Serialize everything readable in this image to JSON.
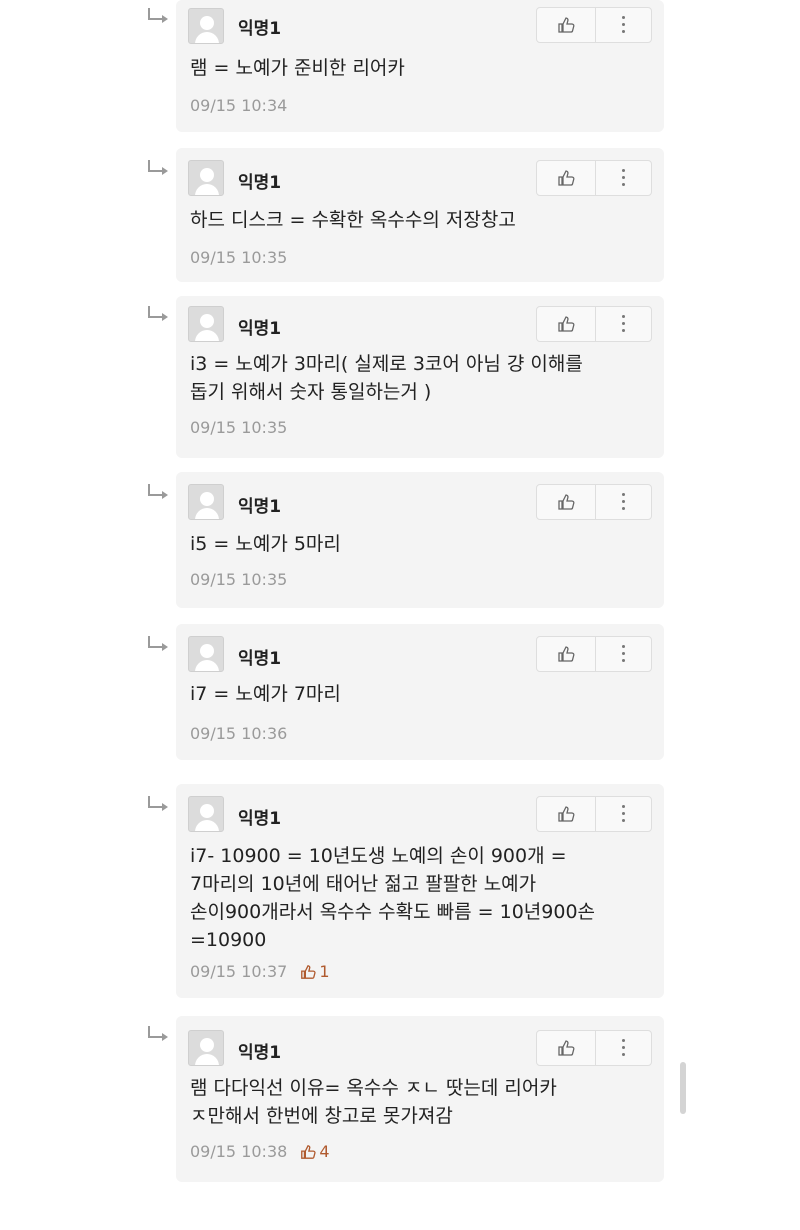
{
  "comments": [
    {
      "author": "익명1",
      "text": "램 = 노예가 준비한 리어카",
      "time": "09/15 10:34",
      "likes": ""
    },
    {
      "author": "익명1",
      "text": "하드 디스크 = 수확한 옥수수의 저장창고",
      "time": "09/15 10:35",
      "likes": ""
    },
    {
      "author": "익명1",
      "text": "i3 = 노예가 3마리( 실제로 3코어 아님 걍 이해를\n돕기 위해서 숫자 통일하는거 )",
      "time": "09/15 10:35",
      "likes": ""
    },
    {
      "author": "익명1",
      "text": "i5 = 노예가 5마리",
      "time": "09/15 10:35",
      "likes": ""
    },
    {
      "author": "익명1",
      "text": "i7 = 노예가 7마리",
      "time": "09/15 10:36",
      "likes": ""
    },
    {
      "author": "익명1",
      "text": "i7- 10900 = 10년도생 노예의 손이 900개 =\n7마리의 10년에 태어난 젊고 팔팔한 노예가\n손이900개라서 옥수수 수확도 빠름 = 10년900손\n=10900",
      "time": "09/15 10:37",
      "likes": "1"
    },
    {
      "author": "익명1",
      "text": "램 다다익선 이유= 옥수수  ㅈㄴ 땃는데 리어카\nㅈ만해서 한번에 창고로 못가져감",
      "time": "09/15 10:38",
      "likes": "4"
    }
  ],
  "icons": {
    "reply": "reply-arrow-icon",
    "avatar": "default-avatar-icon",
    "like": "thumbs-up-icon",
    "more": "more-vertical-icon"
  },
  "colors": {
    "card_bg": "#f4f4f4",
    "meta_text": "#9a9a9a",
    "like_count": "#b05a2e"
  }
}
